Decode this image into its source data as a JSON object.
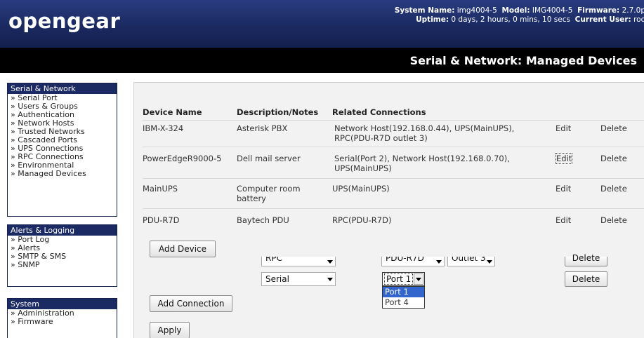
{
  "header": {
    "logo": "opengear",
    "system_name_label": "System Name:",
    "system_name": "img4004-5",
    "model_label": "Model:",
    "model": "IMG4004-5",
    "firmware_label": "Firmware:",
    "firmware": "2.7.0p",
    "uptime_label": "Uptime:",
    "uptime": "0 days, 2 hours, 0 mins, 10 secs",
    "current_user_label": "Current User:",
    "current_user": "roo"
  },
  "page_title": "Serial & Network: Managed Devices",
  "sidebar": {
    "serial_network": {
      "heading": "Serial & Network",
      "items": [
        "» Serial Port",
        "» Users & Groups",
        "» Authentication",
        "» Network Hosts",
        "» Trusted Networks",
        "» Cascaded Ports",
        "» UPS Connections",
        "» RPC Connections",
        "» Environmental",
        "» Managed Devices"
      ]
    },
    "alerts": {
      "heading": "Alerts & Logging",
      "items": [
        "» Port Log",
        "» Alerts",
        "» SMTP & SMS",
        "» SNMP"
      ]
    },
    "system": {
      "heading": "System",
      "items": [
        "» Administration",
        "» Firmware"
      ]
    }
  },
  "table": {
    "headers": [
      "Device Name",
      "Description/Notes",
      "Related Connections"
    ],
    "rows": [
      {
        "name": "IBM-X-324",
        "description": "Asterisk PBX",
        "connections": "Network Host(192.168.0.44), UPS(MainUPS), RPC(PDU-R7D outlet 3)",
        "edit": "Edit",
        "delete": "Delete"
      },
      {
        "name": "PowerEdgeR9000-5",
        "description": "Dell mail server",
        "connections": "Serial(Port 2), Network Host(192.168.0.70), UPS(MainUPS)",
        "edit": "Edit",
        "delete": "Delete"
      },
      {
        "name": "MainUPS",
        "description": "Computer room battery",
        "connections": "UPS(MainUPS)",
        "edit": "Edit",
        "delete": "Delete"
      },
      {
        "name": "PDU-R7D",
        "description": "Baytech PDU",
        "connections": "RPC(PDU-R7D)",
        "edit": "Edit",
        "delete": "Delete"
      }
    ]
  },
  "buttons": {
    "add_device": "Add Device",
    "add_connection": "Add Connection",
    "apply": "Apply",
    "delete_1": "Delete",
    "delete_2": "Delete"
  },
  "connections": {
    "row1": {
      "type": "RPC",
      "target": "PDU-R7D",
      "outlet": "Outlet 3"
    },
    "row2": {
      "type": "Serial",
      "port": "Port 1"
    }
  },
  "port_dropdown": {
    "options": [
      "Port 1",
      "Port 4"
    ],
    "highlighted": "Port 1"
  }
}
